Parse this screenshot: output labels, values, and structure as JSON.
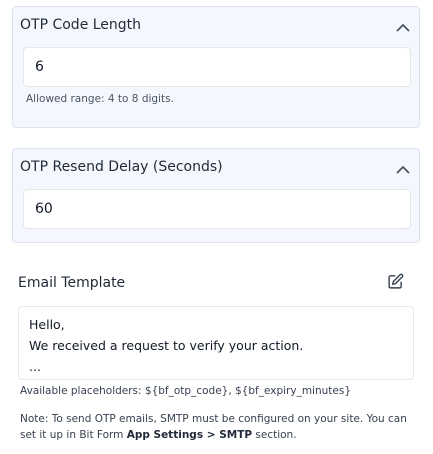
{
  "otp_length": {
    "title": "OTP Code Length",
    "value": "6",
    "hint": "Allowed range: 4 to 8 digits."
  },
  "resend_delay": {
    "title": "OTP Resend Delay (Seconds)",
    "value": "60"
  },
  "email_template": {
    "title": "Email Template",
    "lines": [
      "Hello,",
      "We received a request to verify your action.",
      "..."
    ],
    "placeholders": "Available placeholders: ${bf_otp_code}, ${bf_expiry_minutes}"
  },
  "note": {
    "text_before": "Note: To send OTP emails, SMTP must be configured on your site. You can set it up in Bit Form ",
    "settings_link": "App Settings",
    "separator": " > ",
    "smtp_link": "SMTP",
    "text_after": " section."
  },
  "icons": {
    "collapse": "chevron-up-icon",
    "edit": "edit-pencil-icon"
  }
}
